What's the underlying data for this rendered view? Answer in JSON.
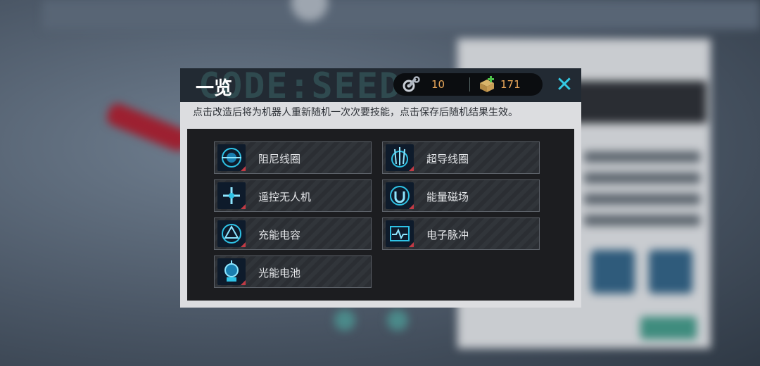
{
  "modal": {
    "title": "一览",
    "decorative_text": "CODE:SEED",
    "instruction": "点击改造后将为机器人重新随机一次次要技能，点击保存后随机结果生效。",
    "close_icon": "close-icon"
  },
  "currency": {
    "parts_icon": "wrench-gear-icon",
    "parts_value": "10",
    "material_icon": "material-box-plus-icon",
    "material_value": "171"
  },
  "skills": [
    {
      "label": "阻尼线圈",
      "icon": "damping-coil-icon"
    },
    {
      "label": "超导线圈",
      "icon": "superconducting-coil-icon"
    },
    {
      "label": "遥控无人机",
      "icon": "remote-drone-icon"
    },
    {
      "label": "能量磁场",
      "icon": "energy-magnetic-field-icon"
    },
    {
      "label": "充能电容",
      "icon": "charging-capacitor-icon"
    },
    {
      "label": "电子脉冲",
      "icon": "electronic-pulse-icon"
    },
    {
      "label": "光能电池",
      "icon": "solar-battery-icon"
    }
  ],
  "colors": {
    "accent_cyan": "#34c8e3",
    "currency_orange": "#e9a75a",
    "corner_red": "#c23a44"
  }
}
